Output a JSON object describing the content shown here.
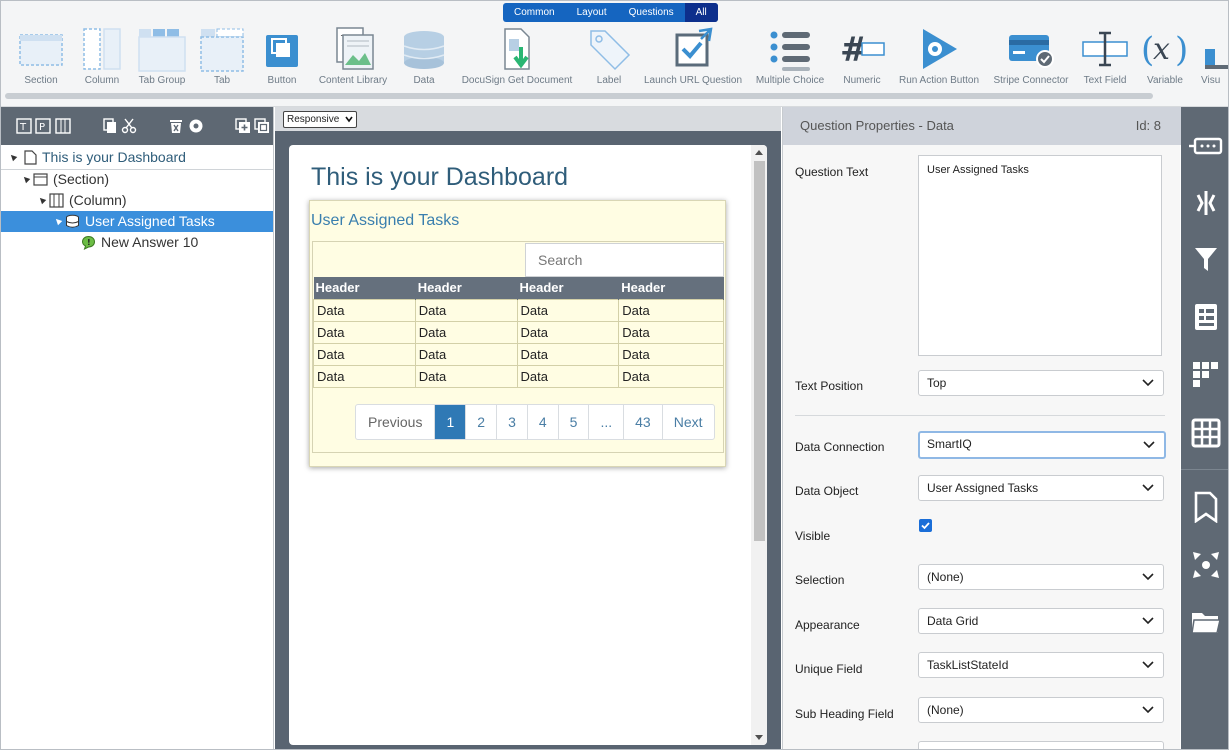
{
  "toolbar": {
    "filter_tabs": [
      "Common",
      "Layout",
      "Questions",
      "All"
    ],
    "active_filter": "All",
    "items": [
      {
        "label": "Section",
        "icon": "section-icon"
      },
      {
        "label": "Column",
        "icon": "column-icon"
      },
      {
        "label": "Tab Group",
        "icon": "tab-group-icon"
      },
      {
        "label": "Tab",
        "icon": "tab-icon"
      },
      {
        "label": "Button",
        "icon": "button-icon"
      },
      {
        "label": "Content Library",
        "icon": "content-library-icon"
      },
      {
        "label": "Data",
        "icon": "data-icon"
      },
      {
        "label": "DocuSign Get Document",
        "icon": "docusign-icon"
      },
      {
        "label": "Label",
        "icon": "label-icon"
      },
      {
        "label": "Launch URL Question",
        "icon": "launch-url-icon"
      },
      {
        "label": "Multiple Choice",
        "icon": "multiple-choice-icon"
      },
      {
        "label": "Numeric",
        "icon": "numeric-icon"
      },
      {
        "label": "Run Action Button",
        "icon": "run-action-icon"
      },
      {
        "label": "Stripe Connector",
        "icon": "stripe-icon"
      },
      {
        "label": "Text Field",
        "icon": "text-field-icon"
      },
      {
        "label": "Variable",
        "icon": "variable-icon"
      },
      {
        "label": "Visu",
        "icon": "visual-icon"
      }
    ]
  },
  "tree": {
    "items": [
      {
        "label": "This is your Dashboard",
        "icon": "page-icon"
      },
      {
        "label": "(Section)",
        "icon": "section-icon"
      },
      {
        "label": "(Column)",
        "icon": "column-icon"
      },
      {
        "label": "User Assigned Tasks",
        "icon": "data-icon"
      },
      {
        "label": "New Answer 10",
        "icon": "answer-icon"
      }
    ]
  },
  "view_mode": "Responsive",
  "canvas": {
    "title": "This is your Dashboard",
    "grid": {
      "title": "User Assigned Tasks",
      "search_placeholder": "Search",
      "headers": [
        "Header",
        "Header",
        "Header",
        "Header"
      ],
      "rows": [
        [
          "Data",
          "Data",
          "Data",
          "Data"
        ],
        [
          "Data",
          "Data",
          "Data",
          "Data"
        ],
        [
          "Data",
          "Data",
          "Data",
          "Data"
        ],
        [
          "Data",
          "Data",
          "Data",
          "Data"
        ]
      ],
      "pager": [
        "Previous",
        "1",
        "2",
        "3",
        "4",
        "5",
        "...",
        "43",
        "Next"
      ],
      "current_page": "1"
    }
  },
  "properties": {
    "header": "Question Properties - Data",
    "id_label": "Id: 8",
    "question_text_label": "Question Text",
    "question_text_value": "User Assigned Tasks",
    "text_position_label": "Text Position",
    "text_position_value": "Top",
    "data_connection_label": "Data Connection",
    "data_connection_value": "SmartIQ",
    "data_object_label": "Data Object",
    "data_object_value": "User Assigned Tasks",
    "visible_label": "Visible",
    "visible_checked": true,
    "selection_label": "Selection",
    "selection_value": "(None)",
    "appearance_label": "Appearance",
    "appearance_value": "Data Grid",
    "unique_field_label": "Unique Field",
    "unique_field_value": "TaskListStateId",
    "sub_heading_label": "Sub Heading Field",
    "sub_heading_value": "(None)"
  },
  "colors": {
    "accent": "#1565c0",
    "selection": "#3b8fdc",
    "grid_background": "#fffde3",
    "header_gray": "#65707d",
    "pager_active": "#2f79b5"
  }
}
